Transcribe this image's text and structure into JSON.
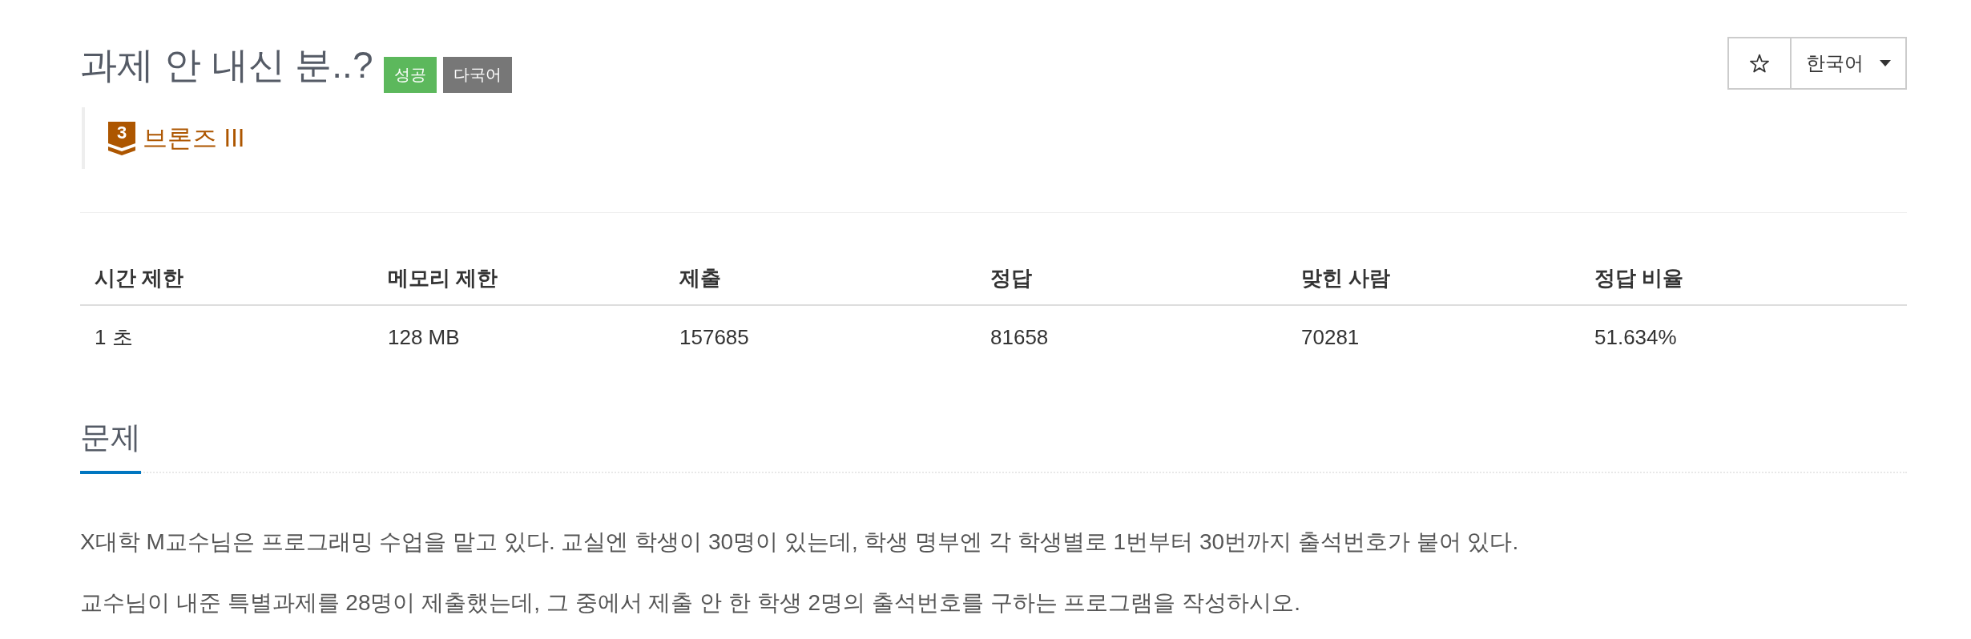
{
  "problem": {
    "title": "과제 안 내신 분..?",
    "badges": [
      {
        "label": "성공",
        "color": "#5cb85c"
      },
      {
        "label": "다국어",
        "color": "#777777"
      }
    ],
    "tier": {
      "kind": "bronze",
      "number": "3",
      "label": "브론즈 III"
    }
  },
  "actions": {
    "favorite": {
      "selected": false
    },
    "language": {
      "value": "한국어"
    }
  },
  "stats": {
    "columns": [
      "시간 제한",
      "메모리 제한",
      "제출",
      "정답",
      "맞힌 사람",
      "정답 비율"
    ],
    "rows": [
      [
        "1 초",
        "128 MB",
        "157685",
        "81658",
        "70281",
        "51.634%"
      ]
    ]
  },
  "section": {
    "heading": "문제",
    "paragraphs": [
      "X대학 M교수님은 프로그래밍 수업을 맡고 있다. 교실엔 학생이 30명이 있는데, 학생 명부엔 각 학생별로 1번부터 30번까지 출석번호가 붙어 있다.",
      "교수님이 내준 특별과제를 28명이 제출했는데, 그 중에서 제출 안 한 학생 2명의 출석번호를 구하는 프로그램을 작성하시오."
    ]
  }
}
